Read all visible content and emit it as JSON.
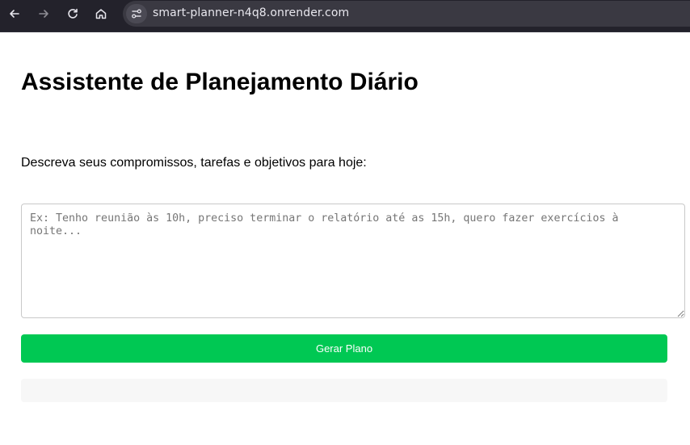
{
  "browser": {
    "url": "smart-planner-n4q8.onrender.com",
    "back_icon": "arrow-left-icon",
    "forward_icon": "arrow-right-icon",
    "reload_icon": "reload-icon",
    "home_icon": "home-icon",
    "site_info_icon": "site-settings-icon"
  },
  "page": {
    "title": "Assistente de Planejamento Diário",
    "prompt_label": "Descreva seus compromissos, tarefas e objetivos para hoje:",
    "input": {
      "value": "",
      "placeholder": "Ex: Tenho reunião às 10h, preciso terminar o relatório até as 15h, quero fazer exercícios à noite..."
    },
    "submit_label": "Gerar Plano",
    "result": ""
  },
  "colors": {
    "button_bg": "#00c853",
    "browser_bar": "#23222b",
    "result_bg": "#f7f7f7"
  }
}
